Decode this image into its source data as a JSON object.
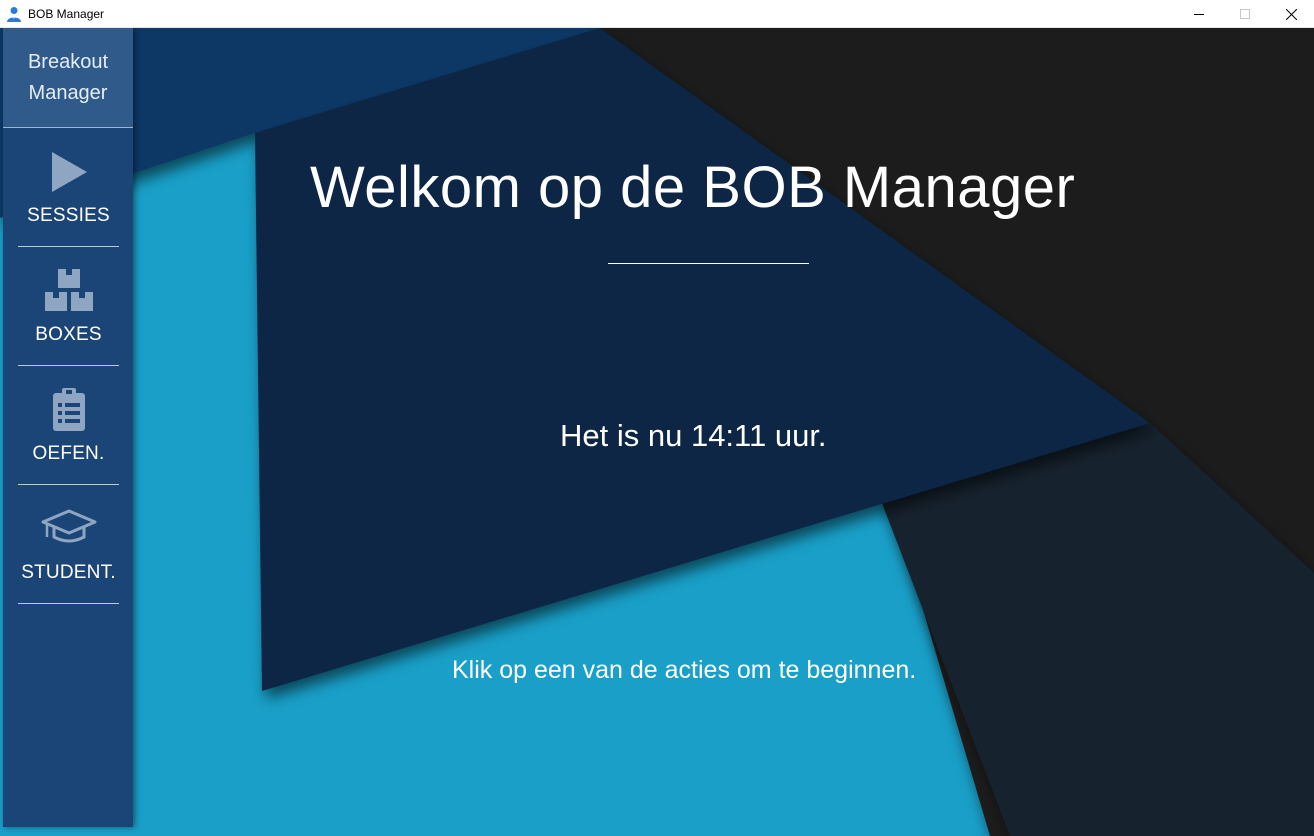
{
  "window": {
    "title": "BOB Manager"
  },
  "sidebar": {
    "brand_line1": "Breakout",
    "brand_line2": "Manager",
    "items": [
      {
        "label": "SESSIES",
        "icon": "play-icon"
      },
      {
        "label": "BOXES",
        "icon": "boxes-icon"
      },
      {
        "label": "OEFEN.",
        "icon": "clipboard-icon"
      },
      {
        "label": "STUDENT.",
        "icon": "graduation-cap-icon"
      }
    ]
  },
  "main": {
    "heading": "Welkom op de BOB Manager",
    "time_text": "Het is nu 14:11 uur.",
    "hint": "Klik op een van de acties om te beginnen."
  },
  "colors": {
    "sidebar": "#1c4577",
    "brand_header": "#2f5a8a",
    "background_light": "#199fc8",
    "panel_navy": "#082545",
    "panel_dark": "#1f1f1f"
  }
}
